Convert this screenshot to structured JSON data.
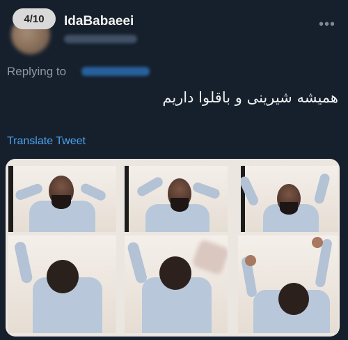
{
  "image_counter": "4/10",
  "author": {
    "username": "IdaBabaeei"
  },
  "reply": {
    "label": "Replying to"
  },
  "tweet": {
    "text": "همیشه شیرینی و باقلوا داریم",
    "translate_label": "Translate Tweet"
  },
  "media": {
    "frames": 6
  },
  "icons": {
    "more": "more-horizontal-icon"
  },
  "colors": {
    "background": "#16202c",
    "link": "#4aa3ee",
    "secondary_text": "#8b98a5"
  }
}
